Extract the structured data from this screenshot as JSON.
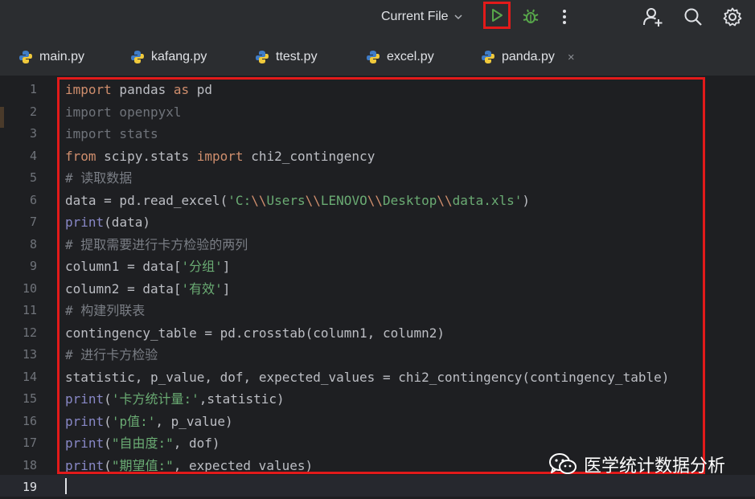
{
  "toolbar": {
    "run_config_label": "Current File",
    "icons": [
      "chevron-down-icon",
      "run-icon",
      "debug-icon",
      "more-icon",
      "add-user-icon",
      "search-icon",
      "gear-icon"
    ],
    "run_color": "#4caf50",
    "debug_color": "#4caf50"
  },
  "tabs": [
    {
      "label": "main.py",
      "icon": "python-icon"
    },
    {
      "label": "kafang.py",
      "icon": "python-icon"
    },
    {
      "label": "ttest.py",
      "icon": "python-icon"
    },
    {
      "label": "excel.py",
      "icon": "python-icon"
    },
    {
      "label": "panda.py",
      "icon": "python-icon",
      "active": true,
      "close": "×"
    }
  ],
  "editor": {
    "line_numbers": [
      "1",
      "2",
      "3",
      "4",
      "5",
      "6",
      "7",
      "8",
      "9",
      "10",
      "11",
      "12",
      "13",
      "14",
      "15",
      "16",
      "17",
      "18",
      "19"
    ],
    "active_line": "19",
    "lines": [
      [
        {
          "t": "import",
          "c": "kw"
        },
        {
          "t": " pandas "
        },
        {
          "t": "as",
          "c": "kw"
        },
        {
          "t": " pd"
        }
      ],
      [
        {
          "t": "import openpyxl",
          "c": "dim"
        }
      ],
      [
        {
          "t": "import stats",
          "c": "dim"
        }
      ],
      [
        {
          "t": "from",
          "c": "kw"
        },
        {
          "t": " scipy.stats "
        },
        {
          "t": "import",
          "c": "kw"
        },
        {
          "t": " chi2_contingency"
        }
      ],
      [
        {
          "t": "# 读取数据",
          "c": "cm"
        }
      ],
      [
        {
          "t": "data = pd.read_excel("
        },
        {
          "t": "'C:",
          "c": "str"
        },
        {
          "t": "\\\\",
          "c": "esc"
        },
        {
          "t": "Users",
          "c": "str"
        },
        {
          "t": "\\\\",
          "c": "esc"
        },
        {
          "t": "LENOVO",
          "c": "str"
        },
        {
          "t": "\\\\",
          "c": "esc"
        },
        {
          "t": "Desktop",
          "c": "str"
        },
        {
          "t": "\\\\",
          "c": "esc"
        },
        {
          "t": "data.xls'",
          "c": "str"
        },
        {
          "t": ")"
        }
      ],
      [
        {
          "t": "print",
          "c": "bi"
        },
        {
          "t": "(data)"
        }
      ],
      [
        {
          "t": "# 提取需要进行卡方检验的两列",
          "c": "cm"
        }
      ],
      [
        {
          "t": "column1 = data["
        },
        {
          "t": "'分组'",
          "c": "str"
        },
        {
          "t": "]"
        }
      ],
      [
        {
          "t": "column2 = data["
        },
        {
          "t": "'有效'",
          "c": "str"
        },
        {
          "t": "]"
        }
      ],
      [
        {
          "t": "# 构建列联表",
          "c": "cm"
        }
      ],
      [
        {
          "t": "contingency_table = pd.crosstab(column1, column2)"
        }
      ],
      [
        {
          "t": "# 进行卡方检验",
          "c": "cm"
        }
      ],
      [
        {
          "t": "statistic, p_value, dof, expected_values = chi2_contingency(contingency_table)"
        }
      ],
      [
        {
          "t": "print",
          "c": "bi"
        },
        {
          "t": "("
        },
        {
          "t": "'卡方统计量:'",
          "c": "str"
        },
        {
          "t": ",statistic)"
        }
      ],
      [
        {
          "t": "print",
          "c": "bi"
        },
        {
          "t": "("
        },
        {
          "t": "'p值:'",
          "c": "str"
        },
        {
          "t": ", p_value)"
        }
      ],
      [
        {
          "t": "print",
          "c": "bi"
        },
        {
          "t": "("
        },
        {
          "t": "\"自由度:\"",
          "c": "str"
        },
        {
          "t": ", dof)"
        }
      ],
      [
        {
          "t": "print",
          "c": "bi"
        },
        {
          "t": "("
        },
        {
          "t": "\"期望值:\"",
          "c": "str"
        },
        {
          "t": ", expected_values)"
        }
      ],
      []
    ]
  },
  "watermark": {
    "icon": "wechat-icon",
    "text": "医学统计数据分析"
  }
}
